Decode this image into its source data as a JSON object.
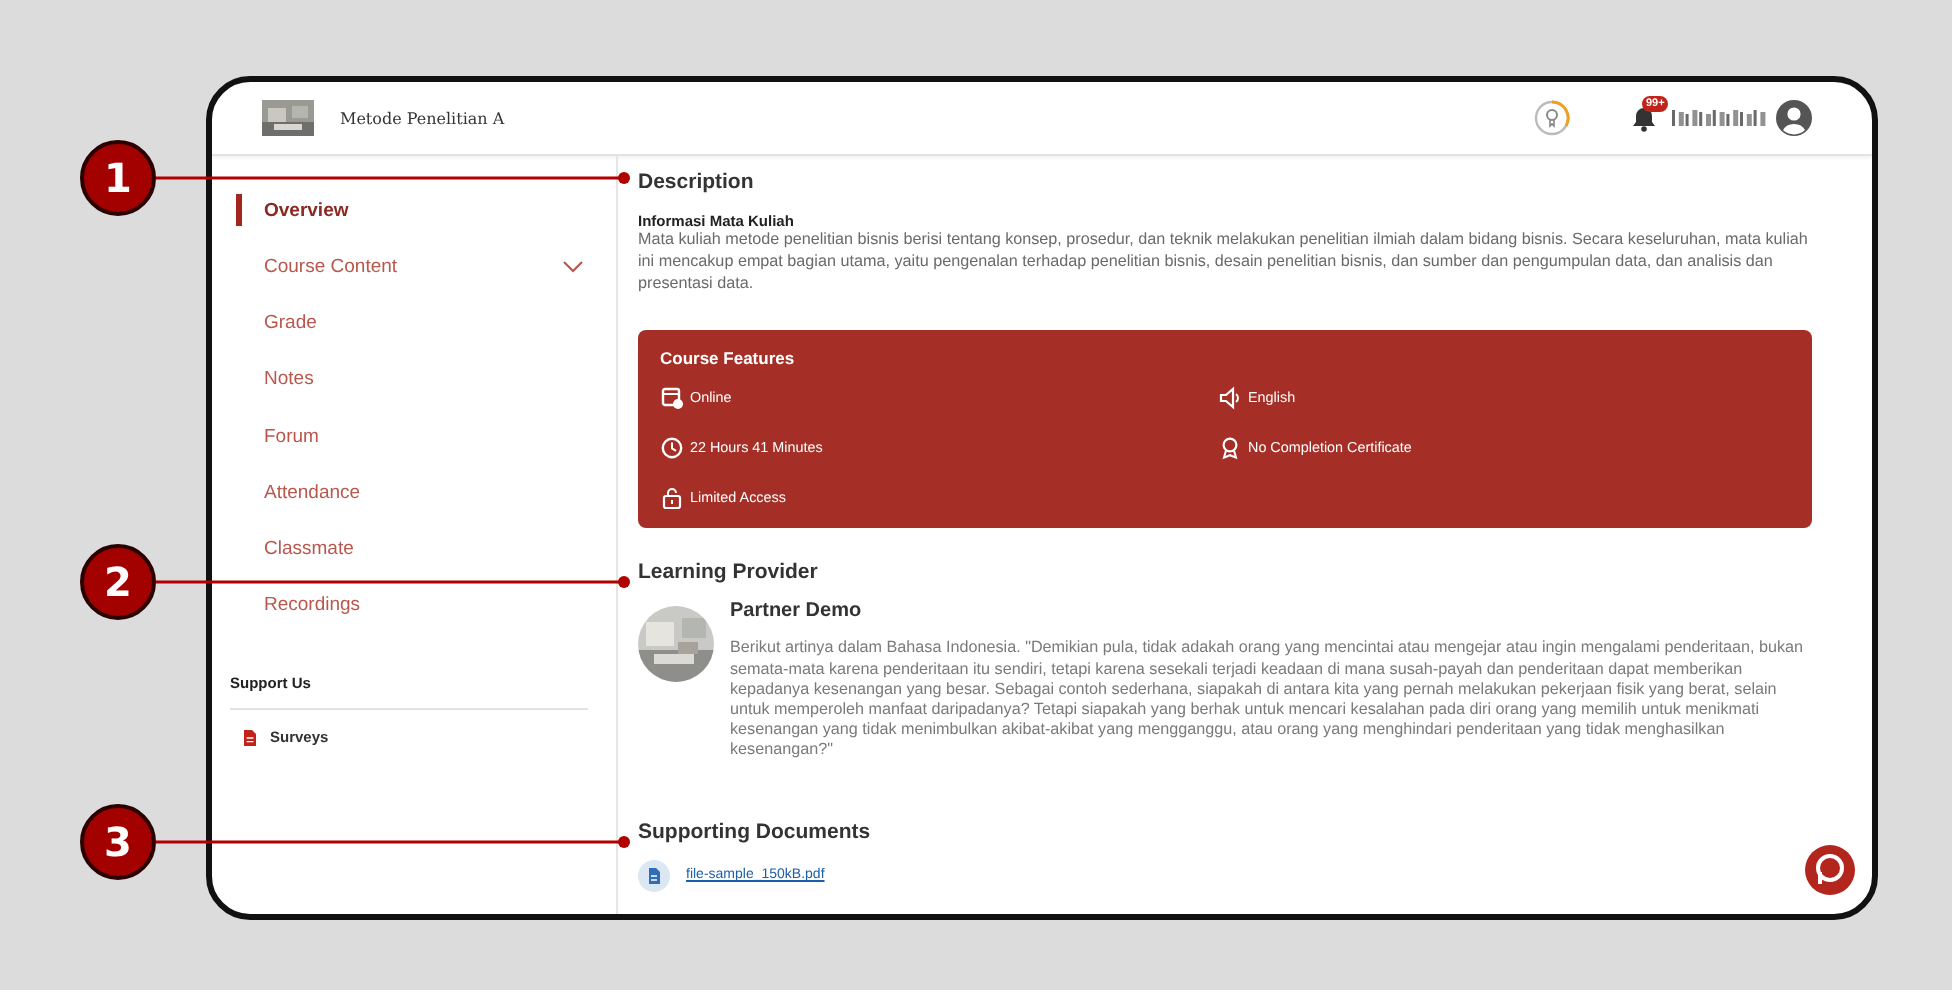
{
  "header": {
    "course_title": "Metode Penelitian A",
    "notification_count": "99+"
  },
  "sidebar": {
    "items": [
      {
        "label": "Overview",
        "selected": true,
        "expandable": false
      },
      {
        "label": "Course Content",
        "selected": false,
        "expandable": true
      },
      {
        "label": "Grade",
        "selected": false,
        "expandable": false
      },
      {
        "label": "Notes",
        "selected": false,
        "expandable": false
      },
      {
        "label": "Forum",
        "selected": false,
        "expandable": false
      },
      {
        "label": "Attendance",
        "selected": false,
        "expandable": false
      },
      {
        "label": "Classmate",
        "selected": false,
        "expandable": false
      },
      {
        "label": "Recordings",
        "selected": false,
        "expandable": false
      }
    ],
    "support_heading": "Support Us",
    "support_items": [
      {
        "label": "Surveys"
      }
    ]
  },
  "description": {
    "heading": "Description",
    "subheading": "Informasi Mata Kuliah",
    "text": "Mata kuliah metode penelitian bisnis berisi tentang konsep, prosedur, dan teknik melakukan penelitian ilmiah dalam bidang bisnis. Secara keseluruhan, mata kuliah ini mencakup empat bagian utama, yaitu pengenalan terhadap penelitian bisnis, desain penelitian bisnis, dan sumber dan pengumpulan data, dan analisis dan presentasi data."
  },
  "course_features": {
    "title": "Course Features",
    "items": [
      {
        "kind": "online",
        "label": "Online"
      },
      {
        "kind": "language",
        "label": "English"
      },
      {
        "kind": "duration",
        "label": "22 Hours 41 Minutes"
      },
      {
        "kind": "certificate",
        "label": "No Completion Certificate"
      },
      {
        "kind": "access",
        "label": "Limited Access"
      }
    ]
  },
  "learning_provider": {
    "heading": "Learning Provider",
    "name": "Partner Demo",
    "text": "Berikut artinya dalam Bahasa Indonesia. \"Demikian pula, tidak adakah orang yang mencintai atau mengejar atau ingin mengalami penderitaan, bukan semata-mata karena penderitaan itu sendiri, tetapi karena sesekali terjadi keadaan di mana susah-payah dan penderitaan dapat memberikan kepadanya kesenangan yang besar. Sebagai contoh sederhana, siapakah di antara kita yang pernah melakukan pekerjaan fisik yang berat, selain untuk memperoleh manfaat daripadanya? Tetapi siapakah yang berhak untuk mencari kesalahan pada diri orang yang memilih untuk menikmati kesenangan yang tidak menimbulkan akibat-akibat yang mengganggu, atau orang yang menghindari penderitaan yang tidak menghasilkan kesenangan?\""
  },
  "supporting_documents": {
    "heading": "Supporting Documents",
    "files": [
      "file-sample_150kB.pdf"
    ]
  },
  "annotations": [
    {
      "label": "1"
    },
    {
      "label": "2"
    },
    {
      "label": "3"
    }
  ]
}
